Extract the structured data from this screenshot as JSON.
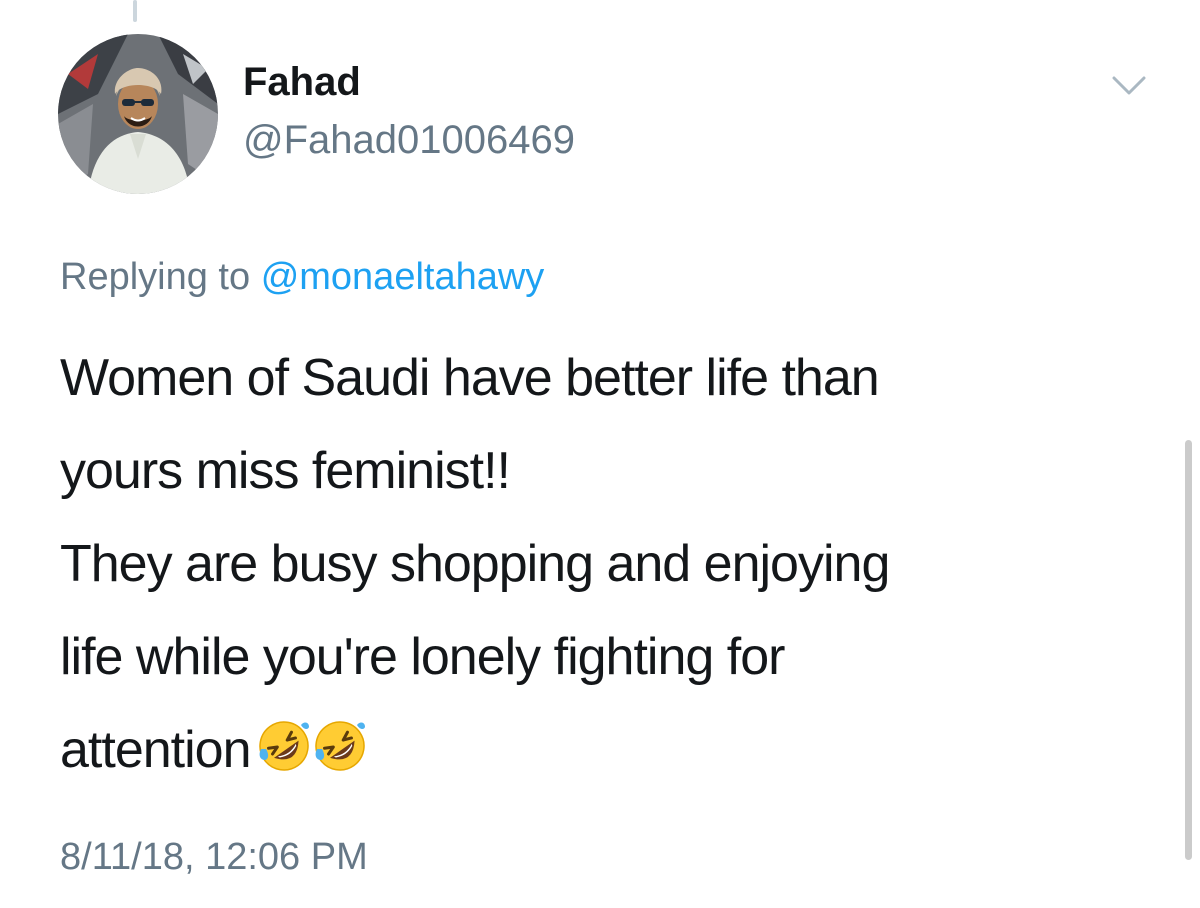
{
  "tweet": {
    "author": {
      "display_name": "Fahad",
      "handle": "@Fahad01006469",
      "avatar_icon": "profile-photo"
    },
    "replying_to": {
      "prefix": "Replying to",
      "mention": "@monaeltahawy"
    },
    "text_lines": [
      "Women of Saudi have better life than",
      "yours miss feminist!!",
      "They are busy shopping and enjoying",
      "life while you're lonely fighting for",
      "attention"
    ],
    "emojis": [
      "rolling-on-floor-laughing-icon",
      "rolling-on-floor-laughing-icon"
    ],
    "timestamp": "8/11/18, 12:06 PM"
  },
  "colors": {
    "text": "#14171a",
    "secondary": "#657786",
    "link": "#1da1f2",
    "thread_line": "#ccd6dd"
  }
}
